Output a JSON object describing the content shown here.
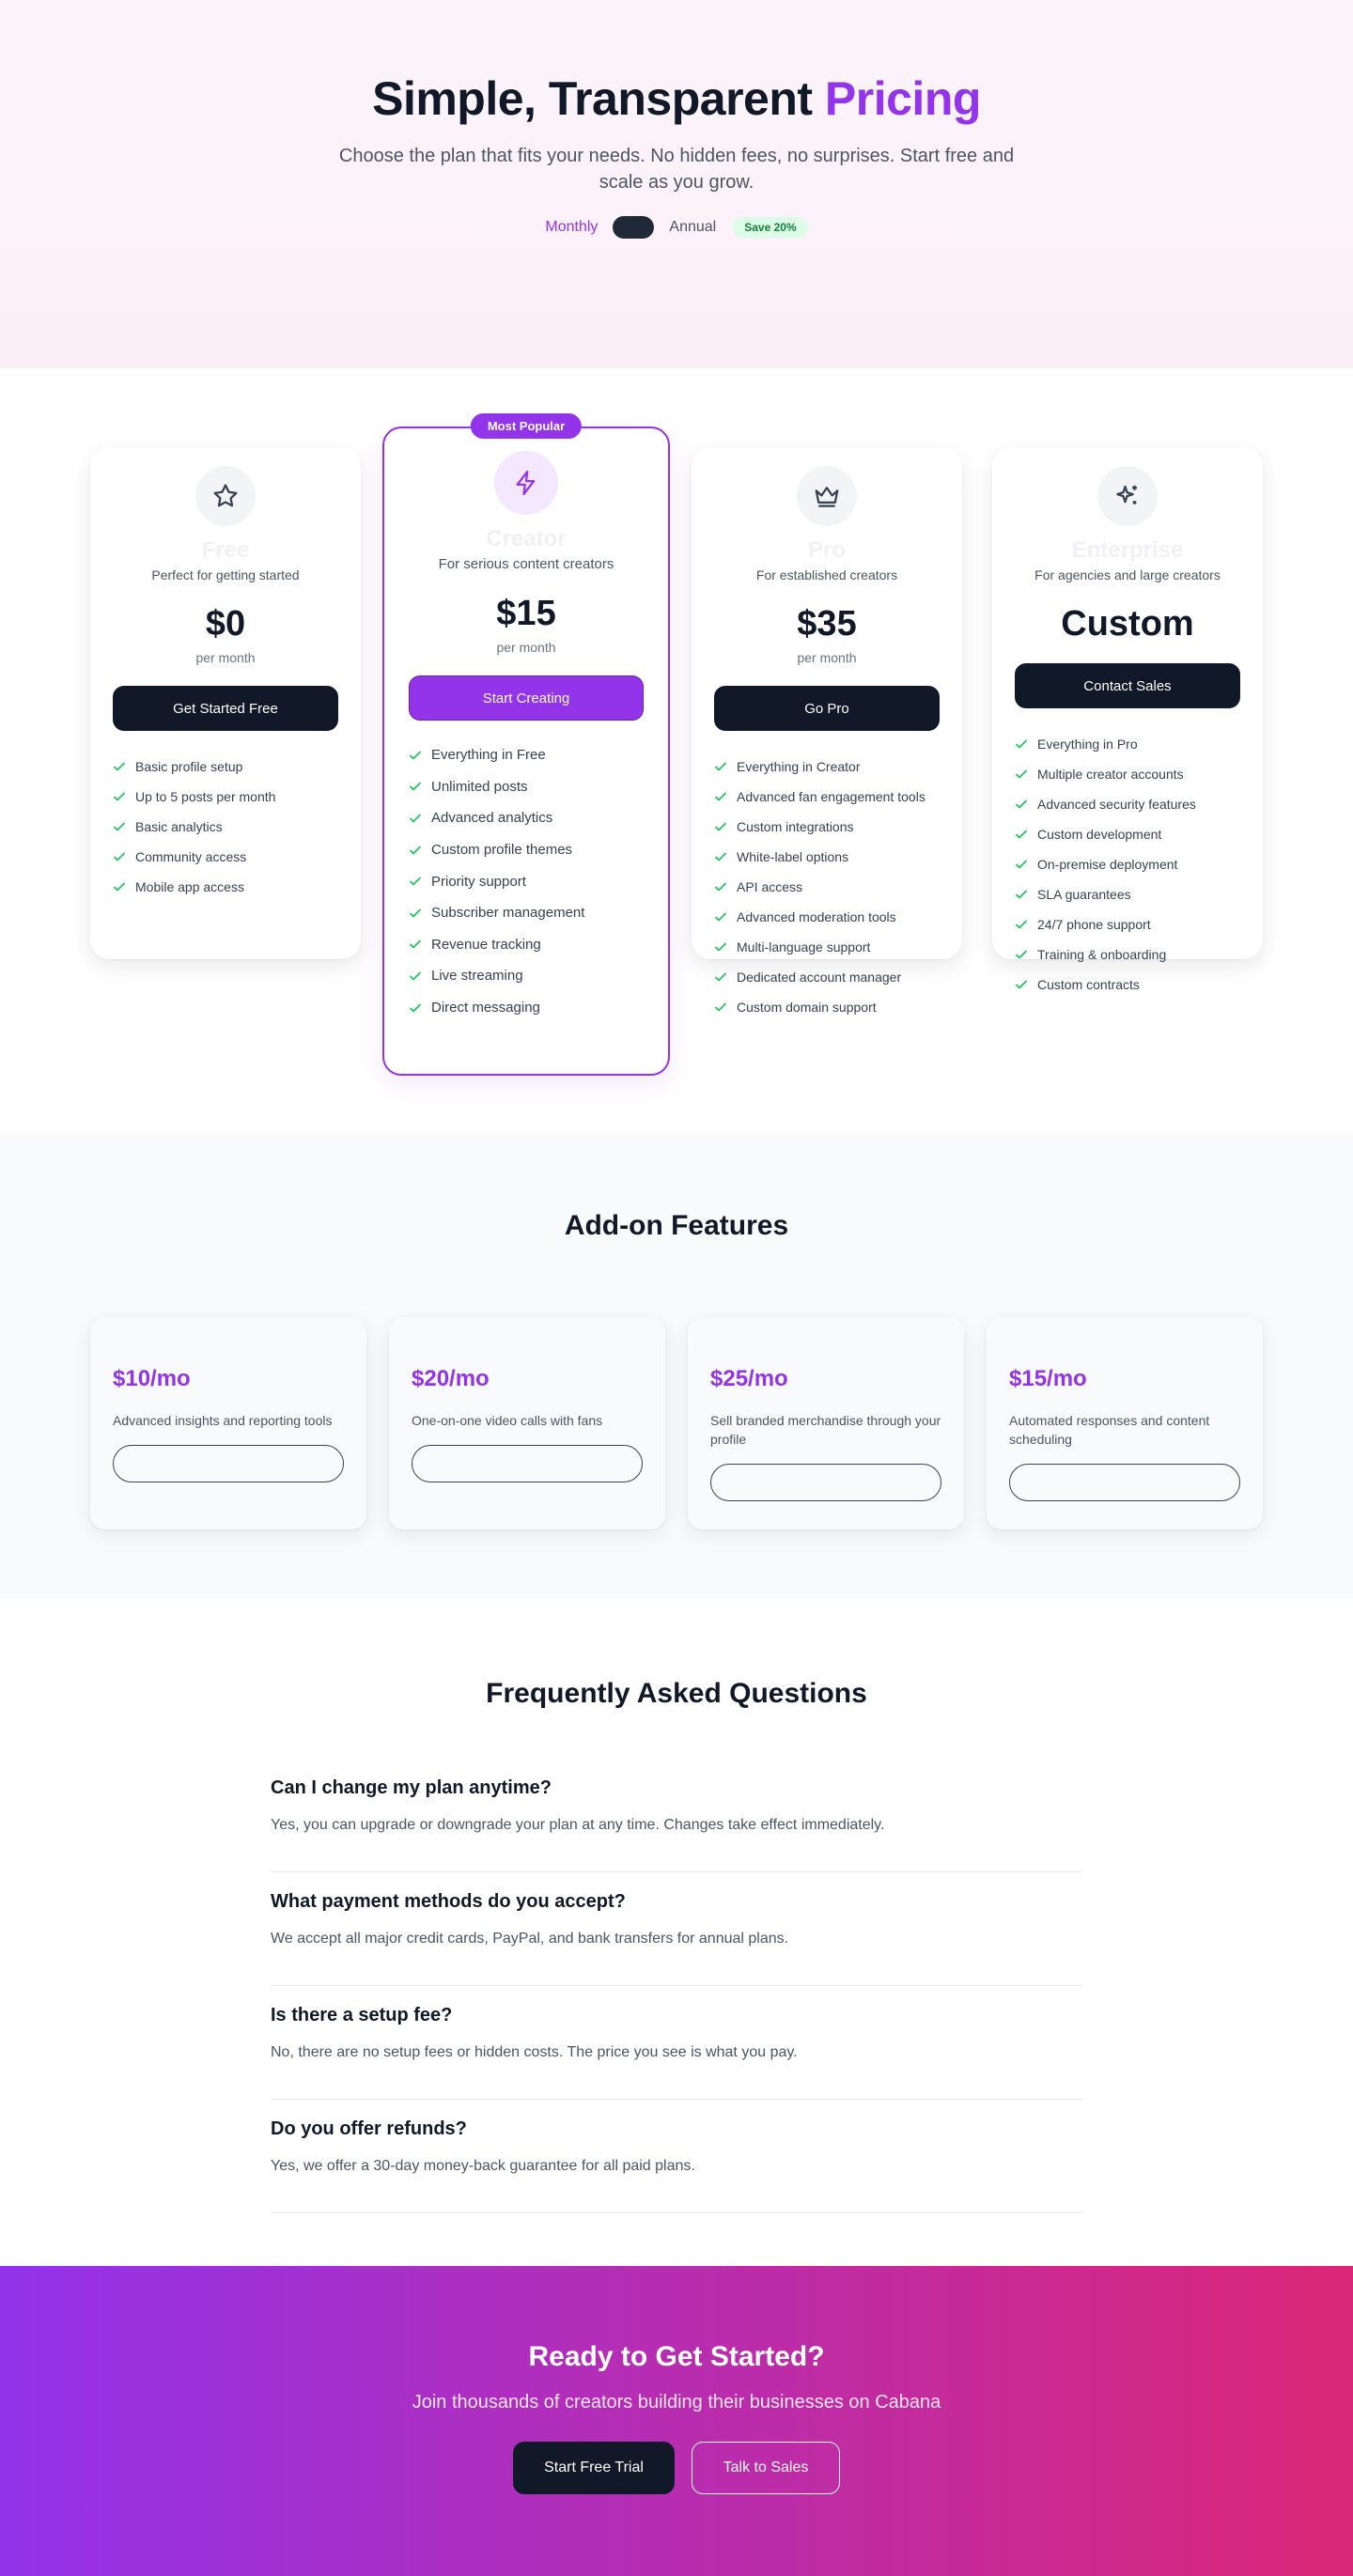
{
  "hero": {
    "title_main": "Simple, Transparent ",
    "title_accent": "Pricing",
    "subtitle": "Choose the plan that fits your needs. No hidden fees, no surprises. Start free and scale as you grow.",
    "billing_monthly": "Monthly",
    "billing_annual": "Annual",
    "save_badge": "Save 20%"
  },
  "plans": [
    {
      "name": "Free",
      "icon": "star-icon",
      "description": "Perfect for getting started",
      "price": "$0",
      "period": "per month",
      "button": "Get Started Free",
      "features": [
        "Basic profile setup",
        "Up to 5 posts per month",
        "Basic analytics",
        "Community access",
        "Mobile app access"
      ]
    },
    {
      "name": "Creator",
      "icon": "lightning-icon",
      "badge": "Most Popular",
      "description": "For serious content creators",
      "price": "$15",
      "period": "per month",
      "button": "Start Creating",
      "features": [
        "Everything in Free",
        "Unlimited posts",
        "Advanced analytics",
        "Custom profile themes",
        "Priority support",
        "Subscriber management",
        "Revenue tracking",
        "Live streaming",
        "Direct messaging"
      ]
    },
    {
      "name": "Pro",
      "icon": "crown-icon",
      "description": "For established creators",
      "price": "$35",
      "period": "per month",
      "button": "Go Pro",
      "features": [
        "Everything in Creator",
        "Advanced fan engagement tools",
        "Custom integrations",
        "White-label options",
        "API access",
        "Advanced moderation tools",
        "Multi-language support",
        "Dedicated account manager",
        "Custom domain support"
      ]
    },
    {
      "name": "Enterprise",
      "icon": "sparkles-icon",
      "description": "For agencies and large creators",
      "price": "Custom",
      "button": "Contact Sales",
      "features": [
        "Everything in Pro",
        "Multiple creator accounts",
        "Advanced security features",
        "Custom development",
        "On-premise deployment",
        "SLA guarantees",
        "24/7 phone support",
        "Training & onboarding",
        "Custom contracts"
      ]
    }
  ],
  "addons": {
    "title": "Add-on Features",
    "items": [
      {
        "price": "$10/mo",
        "description": "Advanced insights and reporting tools"
      },
      {
        "price": "$20/mo",
        "description": "One-on-one video calls with fans"
      },
      {
        "price": "$25/mo",
        "description": "Sell branded merchandise through your profile"
      },
      {
        "price": "$15/mo",
        "description": "Automated responses and content scheduling"
      }
    ]
  },
  "faq": {
    "title": "Frequently Asked Questions",
    "items": [
      {
        "q": "Can I change my plan anytime?",
        "a": "Yes, you can upgrade or downgrade your plan at any time. Changes take effect immediately."
      },
      {
        "q": "What payment methods do you accept?",
        "a": "We accept all major credit cards, PayPal, and bank transfers for annual plans."
      },
      {
        "q": "Is there a setup fee?",
        "a": "No, there are no setup fees or hidden costs. The price you see is what you pay."
      },
      {
        "q": "Do you offer refunds?",
        "a": "Yes, we offer a 30-day money-back guarantee for all paid plans."
      }
    ]
  },
  "cta": {
    "title": "Ready to Get Started?",
    "subtitle": "Join thousands of creators building their businesses on Cabana",
    "primary": "Start Free Trial",
    "secondary": "Talk to Sales"
  },
  "colors": {
    "accent": "#9333ea",
    "dark": "#111827",
    "check": "#22c55e",
    "cta_gradient_start": "#9333ea",
    "cta_gradient_end": "#db2777"
  }
}
